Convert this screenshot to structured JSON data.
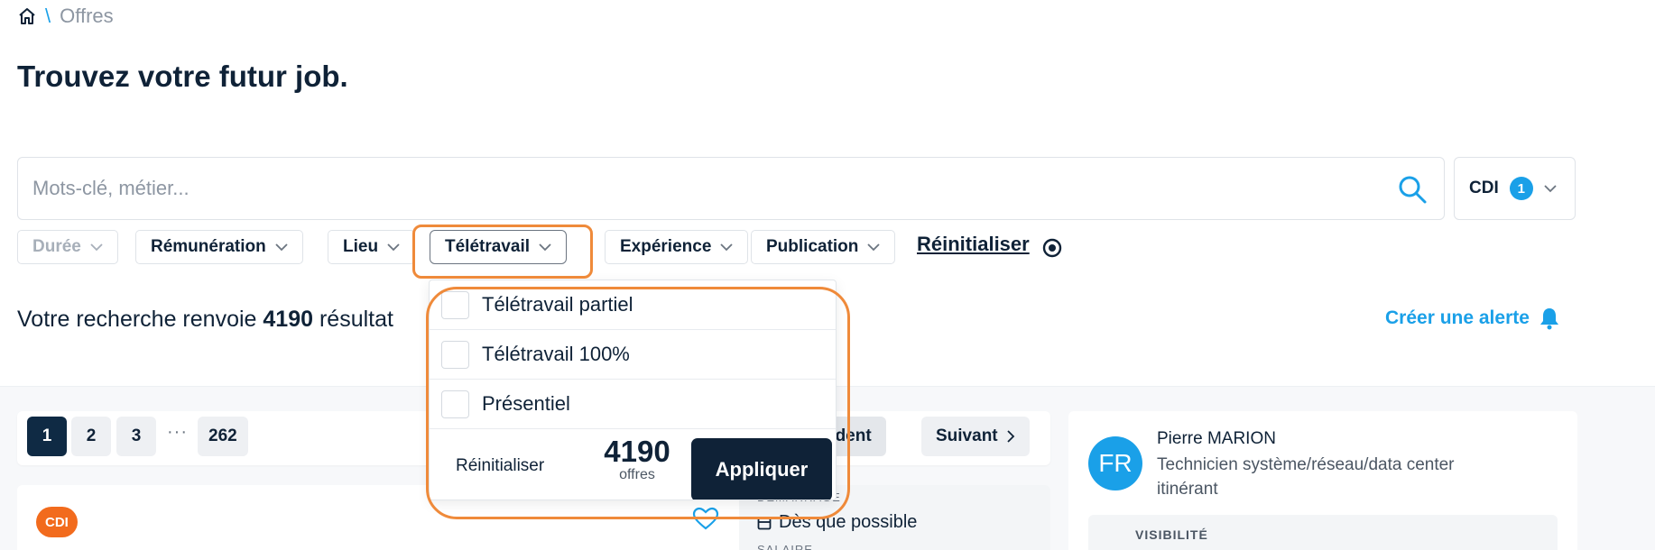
{
  "breadcrumb": {
    "separator": "\\",
    "current": "Offres"
  },
  "page_title": "Trouvez votre futur job.",
  "search": {
    "placeholder": "Mots-clé, métier...",
    "value": ""
  },
  "contract_filter": {
    "label": "CDI",
    "count": "1"
  },
  "filters": [
    {
      "label": "Durée",
      "state": "disabled"
    },
    {
      "label": "Rémunération",
      "state": "normal"
    },
    {
      "label": "Lieu",
      "state": "normal"
    },
    {
      "label": "Télétravail",
      "state": "active"
    },
    {
      "label": "Expérience",
      "state": "normal"
    },
    {
      "label": "Publication",
      "state": "normal"
    }
  ],
  "reset_label": "Réinitialiser",
  "results": {
    "prefix": "Votre recherche renvoie",
    "count": "4190",
    "suffix": "résultat"
  },
  "alert_label": "Créer une alerte",
  "pagination": {
    "pages": [
      "1",
      "2",
      "3",
      "262"
    ],
    "dots": "···",
    "current": "1",
    "prev_label": "édent",
    "next_label": "Suivant"
  },
  "job": {
    "badge": "CDI",
    "start_label": "DÉMARRAGE",
    "start_value": "Dès que possible",
    "salary_label": "SALAIRE"
  },
  "profile": {
    "initials": "FR",
    "name": "Pierre MARION",
    "role": "Technicien système/réseau/data center itinérant",
    "visibility_label": "VISIBILITÉ"
  },
  "teletravail_dropdown": {
    "options": [
      "Télétravail partiel",
      "Télétravail 100%",
      "Présentiel"
    ],
    "reset_label": "Réinitialiser",
    "count": "4190",
    "count_label": "offres",
    "apply_label": "Appliquer"
  },
  "colors": {
    "accent": "#1aa0e8",
    "primary_dark": "#0f2237",
    "annotation": "#ef8a3a",
    "badge": "#f26b1d"
  }
}
